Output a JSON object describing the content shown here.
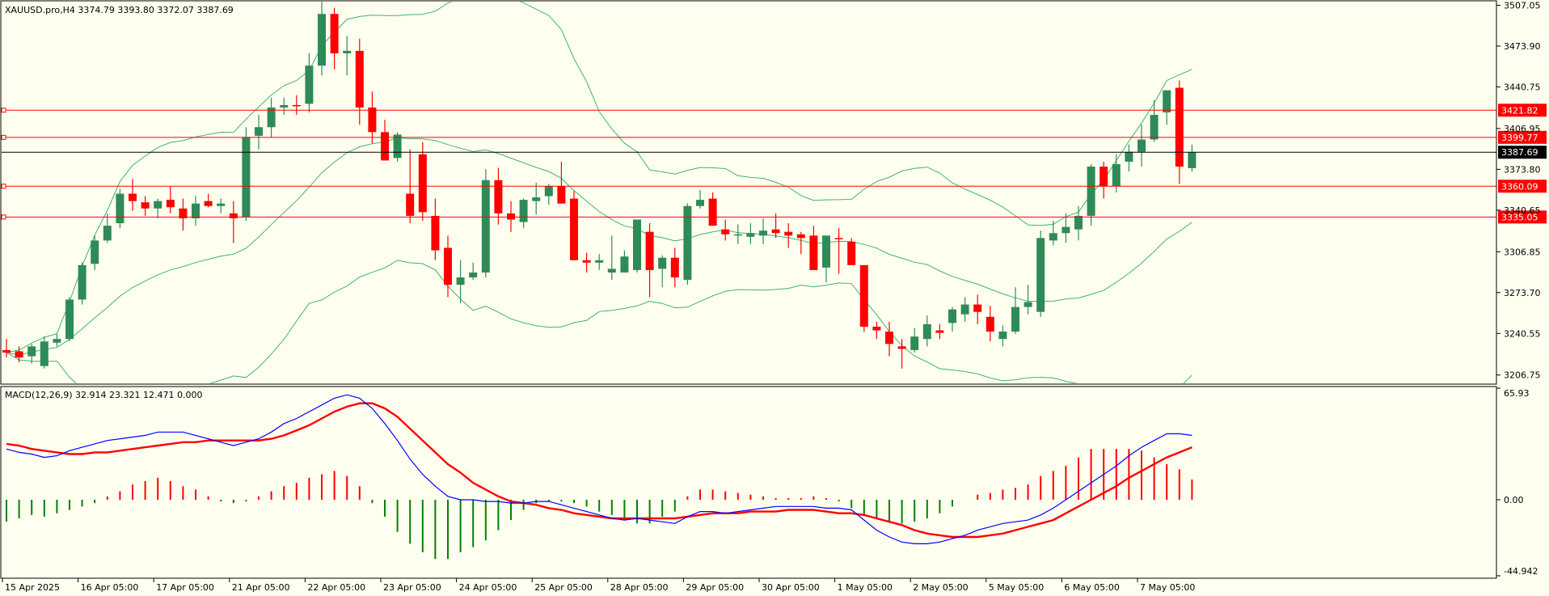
{
  "header": {
    "main": "XAUUSD.pro,H4  3374.79 3393.80 3372.07 3387.69",
    "macd": "MACD(12,26,9) 32.914 23.321 12.471 0.000"
  },
  "colors": {
    "background": "#fffff0",
    "bull": "#2e8b57",
    "bear": "#ff0000",
    "bands": "#3cb371",
    "level": "#ff0000",
    "current": "#000000",
    "macd_line": "#0000ff",
    "signal_line": "#ff0000",
    "hist_pos": "#ff0000",
    "hist_neg": "#008000"
  },
  "chart_data": [
    {
      "type": "candlestick",
      "symbol": "XAUUSD.pro",
      "timeframe": "H4",
      "ylim": [
        3200,
        3510
      ],
      "y_ticks": [
        "3507.05",
        "3473.90",
        "3440.75",
        "3406.95",
        "3373.80",
        "3340.65",
        "3306.85",
        "3273.70",
        "3240.55",
        "3206.75"
      ],
      "x_ticks": [
        "15 Apr 2025",
        "16 Apr 05:00",
        "17 Apr 05:00",
        "21 Apr 05:00",
        "22 Apr 05:00",
        "23 Apr 05:00",
        "24 Apr 05:00",
        "25 Apr 05:00",
        "28 Apr 05:00",
        "29 Apr 05:00",
        "30 Apr 05:00",
        "1 May 05:00",
        "2 May 05:00",
        "5 May 05:00",
        "6 May 05:00",
        "7 May 05:00"
      ],
      "levels": [
        "3421.82",
        "3399.77",
        "3360.09",
        "3335.05"
      ],
      "current_price": "3387.69",
      "ohlc": [
        [
          3227,
          3236,
          3221,
          3225
        ],
        [
          3226,
          3230,
          3217,
          3221
        ],
        [
          3222,
          3232,
          3216,
          3230
        ],
        [
          3214,
          3238,
          3212,
          3234
        ],
        [
          3233,
          3240,
          3230,
          3236
        ],
        [
          3236,
          3270,
          3234,
          3268
        ],
        [
          3268,
          3298,
          3264,
          3296
        ],
        [
          3297,
          3320,
          3292,
          3316
        ],
        [
          3316,
          3338,
          3314,
          3328
        ],
        [
          3330,
          3358,
          3326,
          3354
        ],
        [
          3354,
          3366,
          3340,
          3348
        ],
        [
          3347,
          3352,
          3336,
          3342
        ],
        [
          3342,
          3350,
          3334,
          3348
        ],
        [
          3349,
          3360,
          3338,
          3343
        ],
        [
          3342,
          3350,
          3324,
          3334
        ],
        [
          3334,
          3352,
          3328,
          3346
        ],
        [
          3348,
          3354,
          3343,
          3344
        ],
        [
          3344,
          3350,
          3338,
          3346
        ],
        [
          3338,
          3348,
          3314,
          3334
        ],
        [
          3335,
          3408,
          3332,
          3400
        ],
        [
          3401,
          3418,
          3390,
          3408
        ],
        [
          3408,
          3432,
          3400,
          3424
        ],
        [
          3424,
          3432,
          3418,
          3426
        ],
        [
          3426,
          3434,
          3418,
          3425
        ],
        [
          3427,
          3468,
          3420,
          3458
        ],
        [
          3458,
          3510,
          3450,
          3500
        ],
        [
          3500,
          3505,
          3455,
          3468
        ],
        [
          3468,
          3482,
          3450,
          3470
        ],
        [
          3470,
          3480,
          3410,
          3424
        ],
        [
          3424,
          3437,
          3395,
          3404
        ],
        [
          3404,
          3414,
          3384,
          3381
        ],
        [
          3383,
          3404,
          3380,
          3402
        ],
        [
          3354,
          3390,
          3330,
          3336
        ],
        [
          3386,
          3396,
          3332,
          3339
        ],
        [
          3336,
          3350,
          3300,
          3308
        ],
        [
          3310,
          3320,
          3270,
          3280
        ],
        [
          3280,
          3300,
          3265,
          3286
        ],
        [
          3286,
          3298,
          3284,
          3290
        ],
        [
          3290,
          3374,
          3286,
          3365
        ],
        [
          3365,
          3375,
          3329,
          3338
        ],
        [
          3338,
          3348,
          3323,
          3333
        ],
        [
          3331,
          3350,
          3326,
          3349
        ],
        [
          3348,
          3363,
          3337,
          3351
        ],
        [
          3352,
          3362,
          3345,
          3360
        ],
        [
          3360,
          3380,
          3354,
          3346
        ],
        [
          3350,
          3356,
          3300,
          3300
        ],
        [
          3300,
          3306,
          3290,
          3298
        ],
        [
          3298,
          3305,
          3292,
          3300
        ],
        [
          3290,
          3320,
          3284,
          3293
        ],
        [
          3290,
          3308,
          3290,
          3303
        ],
        [
          3292,
          3322,
          3290,
          3333
        ],
        [
          3323,
          3330,
          3270,
          3292
        ],
        [
          3293,
          3304,
          3278,
          3302
        ],
        [
          3302,
          3310,
          3278,
          3286
        ],
        [
          3284,
          3346,
          3280,
          3344
        ],
        [
          3344,
          3357,
          3342,
          3349
        ],
        [
          3350,
          3355,
          3331,
          3328
        ],
        [
          3325,
          3333,
          3316,
          3321
        ],
        [
          3320,
          3329,
          3313,
          3321
        ],
        [
          3319,
          3330,
          3313,
          3322
        ],
        [
          3320,
          3334,
          3313,
          3324
        ],
        [
          3325,
          3338,
          3318,
          3322
        ],
        [
          3323,
          3330,
          3310,
          3320
        ],
        [
          3321,
          3323,
          3305,
          3318
        ],
        [
          3320,
          3328,
          3296,
          3292
        ],
        [
          3294,
          3318,
          3282,
          3320
        ],
        [
          3318,
          3326,
          3289,
          3317
        ],
        [
          3315,
          3318,
          3298,
          3296
        ],
        [
          3296,
          3292,
          3242,
          3246
        ],
        [
          3246,
          3250,
          3236,
          3243
        ],
        [
          3242,
          3250,
          3222,
          3232
        ],
        [
          3230,
          3236,
          3212,
          3228
        ],
        [
          3227,
          3245,
          3225,
          3238
        ],
        [
          3236,
          3255,
          3230,
          3248
        ],
        [
          3243,
          3248,
          3236,
          3241
        ],
        [
          3249,
          3262,
          3242,
          3260
        ],
        [
          3256,
          3270,
          3250,
          3264
        ],
        [
          3264,
          3272,
          3248,
          3258
        ],
        [
          3254,
          3263,
          3234,
          3242
        ],
        [
          3236,
          3247,
          3230,
          3242
        ],
        [
          3242,
          3278,
          3240,
          3262
        ],
        [
          3262,
          3280,
          3256,
          3266
        ],
        [
          3258,
          3324,
          3254,
          3318
        ],
        [
          3316,
          3332,
          3312,
          3322
        ],
        [
          3322,
          3338,
          3314,
          3327
        ],
        [
          3325,
          3344,
          3316,
          3336
        ],
        [
          3336,
          3378,
          3328,
          3376
        ],
        [
          3376,
          3380,
          3350,
          3360
        ],
        [
          3360,
          3386,
          3355,
          3378
        ],
        [
          3380,
          3394,
          3372,
          3388
        ],
        [
          3388,
          3410,
          3376,
          3398
        ],
        [
          3398,
          3430,
          3396,
          3418
        ],
        [
          3420,
          3428,
          3410,
          3438
        ],
        [
          3440,
          3446,
          3362,
          3376
        ],
        [
          3374.79,
          3393.8,
          3372.07,
          3387.69
        ]
      ]
    },
    {
      "type": "macd",
      "params": "12,26,9",
      "ylim": [
        -44.942,
        65.93
      ],
      "y_ticks": [
        "65.93",
        "0.00",
        "-44.942"
      ],
      "macd": [
        30,
        28,
        27,
        25,
        26,
        29,
        31,
        33,
        35,
        36,
        37,
        38,
        40,
        40,
        40,
        38,
        36,
        34,
        32,
        34,
        36,
        40,
        45,
        48,
        52,
        56,
        60,
        62,
        60,
        54,
        45,
        35,
        24,
        15,
        8,
        2,
        0,
        0,
        -1,
        -1,
        -2,
        -2,
        -1,
        -1,
        -3,
        -5,
        -7,
        -9,
        -11,
        -12,
        -11,
        -12,
        -13,
        -14,
        -10,
        -7,
        -7,
        -8,
        -7,
        -6,
        -5,
        -4,
        -4,
        -4,
        -4,
        -5,
        -5,
        -6,
        -12,
        -18,
        -22,
        -25,
        -26,
        -26,
        -25,
        -23,
        -21,
        -18,
        -16,
        -14,
        -13,
        -12,
        -9,
        -5,
        0,
        5,
        10,
        15,
        20,
        26,
        31,
        35,
        39,
        39,
        38
      ],
      "signal": [
        33,
        32,
        30,
        29,
        28,
        27,
        27,
        28,
        28,
        29,
        30,
        31,
        32,
        33,
        34,
        34,
        35,
        35,
        35,
        35,
        35,
        36,
        38,
        41,
        44,
        48,
        52,
        55,
        57,
        57,
        54,
        49,
        42,
        35,
        28,
        21,
        16,
        10,
        6,
        2,
        -1,
        -2,
        -3,
        -5,
        -6,
        -8,
        -9,
        -10,
        -11,
        -11,
        -11,
        -11,
        -11,
        -11,
        -10,
        -9,
        -8,
        -8,
        -8,
        -7,
        -7,
        -7,
        -6,
        -6,
        -6,
        -7,
        -8,
        -8,
        -9,
        -11,
        -13,
        -15,
        -18,
        -20,
        -21,
        -22,
        -22,
        -22,
        -21,
        -20,
        -18,
        -16,
        -14,
        -12,
        -8,
        -4,
        0,
        4,
        8,
        13,
        17,
        21,
        25,
        28,
        31
      ],
      "histogram": [
        -13,
        -11,
        -9,
        -10,
        -8,
        -6,
        -4,
        -2,
        2,
        5,
        9,
        11,
        13,
        11,
        8,
        6,
        2,
        -1,
        -2,
        -1,
        2,
        5,
        8,
        10,
        13,
        15,
        17,
        14,
        8,
        -2,
        -10,
        -19,
        -26,
        -31,
        -35,
        -35,
        -31,
        -28,
        -24,
        -18,
        -12,
        -6,
        -2,
        -1,
        -1,
        -2,
        -4,
        -7,
        -9,
        -12,
        -14,
        -14,
        -10,
        -7,
        2,
        6,
        6,
        5,
        4,
        3,
        2,
        1,
        1,
        1,
        2,
        1,
        -1,
        -5,
        -9,
        -11,
        -13,
        -14,
        -13,
        -11,
        -8,
        -4,
        0,
        3,
        4,
        6,
        7,
        9,
        14,
        17,
        20,
        25,
        30,
        30,
        30,
        30,
        29,
        25,
        21,
        18,
        12
      ]
    }
  ]
}
